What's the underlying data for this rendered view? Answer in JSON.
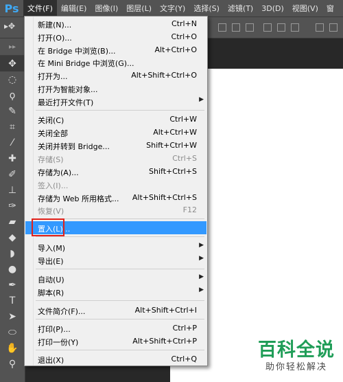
{
  "app": {
    "logo": "Ps"
  },
  "menubar": [
    "文件(F)",
    "编辑(E)",
    "图像(I)",
    "图层(L)",
    "文字(Y)",
    "选择(S)",
    "滤镜(T)",
    "3D(D)",
    "视图(V)",
    "窗"
  ],
  "file_menu": {
    "new": {
      "label": "新建(N)...",
      "shortcut": "Ctrl+N"
    },
    "open": {
      "label": "打开(O)...",
      "shortcut": "Ctrl+O"
    },
    "browse_bridge": {
      "label": "在 Bridge 中浏览(B)...",
      "shortcut": "Alt+Ctrl+O"
    },
    "browse_mini_bridge": {
      "label": "在 Mini Bridge 中浏览(G)..."
    },
    "open_as": {
      "label": "打开为...",
      "shortcut": "Alt+Shift+Ctrl+O"
    },
    "open_smart_object": {
      "label": "打开为智能对象..."
    },
    "recent_files": {
      "label": "最近打开文件(T)"
    },
    "close": {
      "label": "关闭(C)",
      "shortcut": "Ctrl+W"
    },
    "close_all": {
      "label": "关闭全部",
      "shortcut": "Alt+Ctrl+W"
    },
    "close_to_bridge": {
      "label": "关闭并转到 Bridge...",
      "shortcut": "Shift+Ctrl+W"
    },
    "save": {
      "label": "存储(S)",
      "shortcut": "Ctrl+S"
    },
    "save_as": {
      "label": "存储为(A)...",
      "shortcut": "Shift+Ctrl+S"
    },
    "check_in": {
      "label": "签入(I)..."
    },
    "save_for_web": {
      "label": "存储为 Web 所用格式...",
      "shortcut": "Alt+Shift+Ctrl+S"
    },
    "revert": {
      "label": "恢复(V)",
      "shortcut": "F12"
    },
    "place": {
      "label": "置入(L)..."
    },
    "import": {
      "label": "导入(M)"
    },
    "export": {
      "label": "导出(E)"
    },
    "automate": {
      "label": "自动(U)"
    },
    "scripts": {
      "label": "脚本(R)"
    },
    "file_info": {
      "label": "文件简介(F)...",
      "shortcut": "Alt+Shift+Ctrl+I"
    },
    "print": {
      "label": "打印(P)...",
      "shortcut": "Ctrl+P"
    },
    "print_one_copy": {
      "label": "打印一份(Y)",
      "shortcut": "Alt+Shift+Ctrl+P"
    },
    "exit": {
      "label": "退出(X)",
      "shortcut": "Ctrl+Q"
    }
  },
  "watermark": {
    "title": "百科全说",
    "subtitle": "助你轻松解决"
  },
  "colors": {
    "highlight": "#3399ff",
    "outline": "#e0211a",
    "watermark_green": "#1f9d57"
  }
}
